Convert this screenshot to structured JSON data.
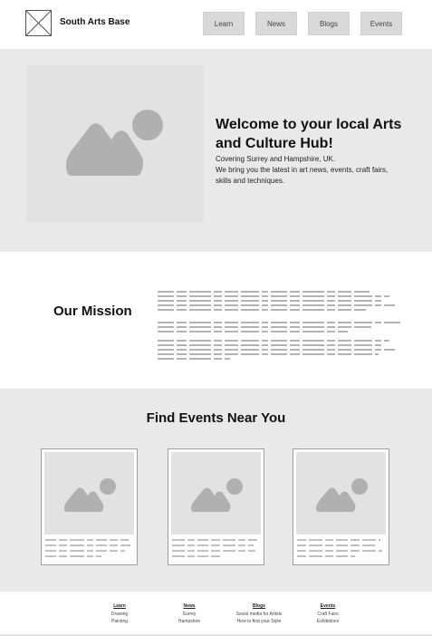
{
  "header": {
    "site_name": "South Arts Base",
    "nav": [
      {
        "label": "Learn"
      },
      {
        "label": "News"
      },
      {
        "label": "Blogs"
      },
      {
        "label": "Events"
      }
    ]
  },
  "hero": {
    "title": "Welcome to your local Arts and Culture Hub!",
    "subtitle_line1": "Covering Surrey and Hampshire, UK.",
    "subtitle_line2": "We bring you the latest in art news, events, craft fairs, skills and techniques.",
    "image_icon": "image-placeholder-icon"
  },
  "mission": {
    "title": "Our Mission"
  },
  "events": {
    "title": "Find Events Near You"
  },
  "footer": {
    "columns": [
      {
        "heading": "Learn",
        "links": [
          "Drawing",
          "Painting"
        ]
      },
      {
        "heading": "News",
        "links": [
          "Surrey",
          "Hampshire"
        ]
      },
      {
        "heading": "Blogs",
        "links": [
          "Social media for Artists",
          "How to find your Style"
        ]
      },
      {
        "heading": "Events",
        "links": [
          "Craft Fairs",
          "Exhibitions"
        ]
      }
    ]
  },
  "colors": {
    "section_gray": "#e9e9e9",
    "placeholder_fill": "#e2e2e2",
    "placeholder_icon": "#b0b0b0",
    "nav_button": "#d9d9d9",
    "text_line": "#9a9a9a"
  }
}
